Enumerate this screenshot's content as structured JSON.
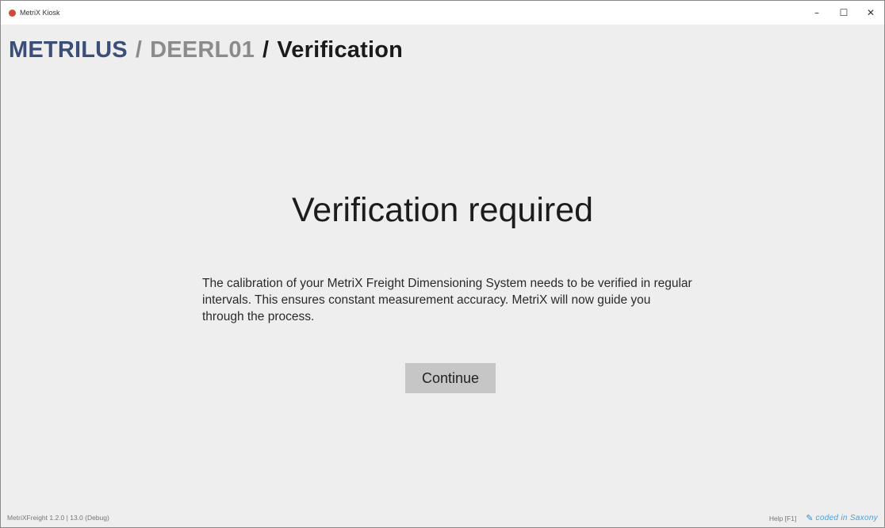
{
  "window": {
    "title": "MetriX Kiosk",
    "controls": {
      "minimize": "–",
      "maximize": "☐",
      "close": "✕"
    }
  },
  "breadcrumb": {
    "brand": "METRILUS",
    "separator": "/",
    "device": "DEERL01",
    "current": "Verification"
  },
  "content": {
    "heading": "Verification required",
    "description": "The calibration of your MetriX Freight Dimensioning System needs to be verified in regular intervals. This ensures constant measurement accuracy. MetriX will now guide you through the process.",
    "continue_label": "Continue"
  },
  "status": {
    "version": "MetriXFreight 1.2.0 | 13.0 (Debug)",
    "help": "Help [F1]",
    "coded_in": "coded in Saxony"
  },
  "colors": {
    "brand": "#3b4e78",
    "device": "#8b8b8b",
    "button": "#c6c6c6",
    "accent": "#2c8fd6"
  },
  "icons": {
    "app": "app-logo-icon",
    "pen": "pen-icon"
  }
}
